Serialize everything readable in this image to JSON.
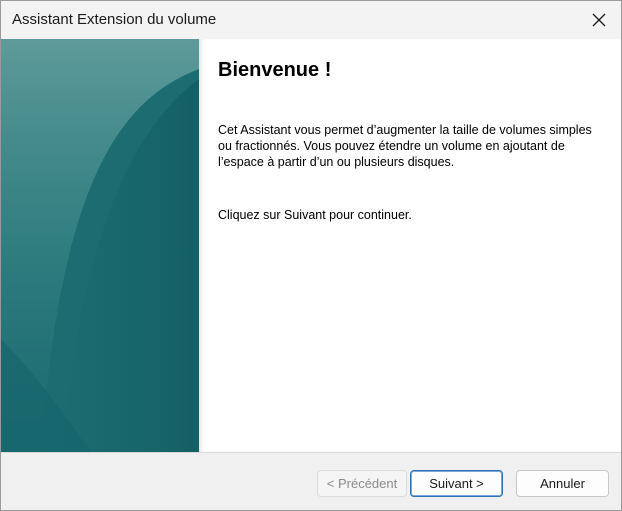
{
  "window": {
    "title": "Assistant Extension du volume"
  },
  "content": {
    "heading": "Bienvenue !",
    "paragraph1": "Cet Assistant vous permet d’augmenter la taille de volumes simples ou fractionnés. Vous pouvez étendre un volume en ajoutant de l’espace à partir d’un ou plusieurs disques.",
    "paragraph2": "Cliquez sur Suivant pour continuer."
  },
  "footer": {
    "prev_label": "< Précédent",
    "next_label": "Suivant >",
    "cancel_label": "Annuler"
  },
  "icons": {
    "close": "close-icon"
  },
  "colors": {
    "side_panel_primary": "#1f6f74",
    "side_panel_highlight": "#5a9a98",
    "default_button_border": "#2f6fb5"
  }
}
